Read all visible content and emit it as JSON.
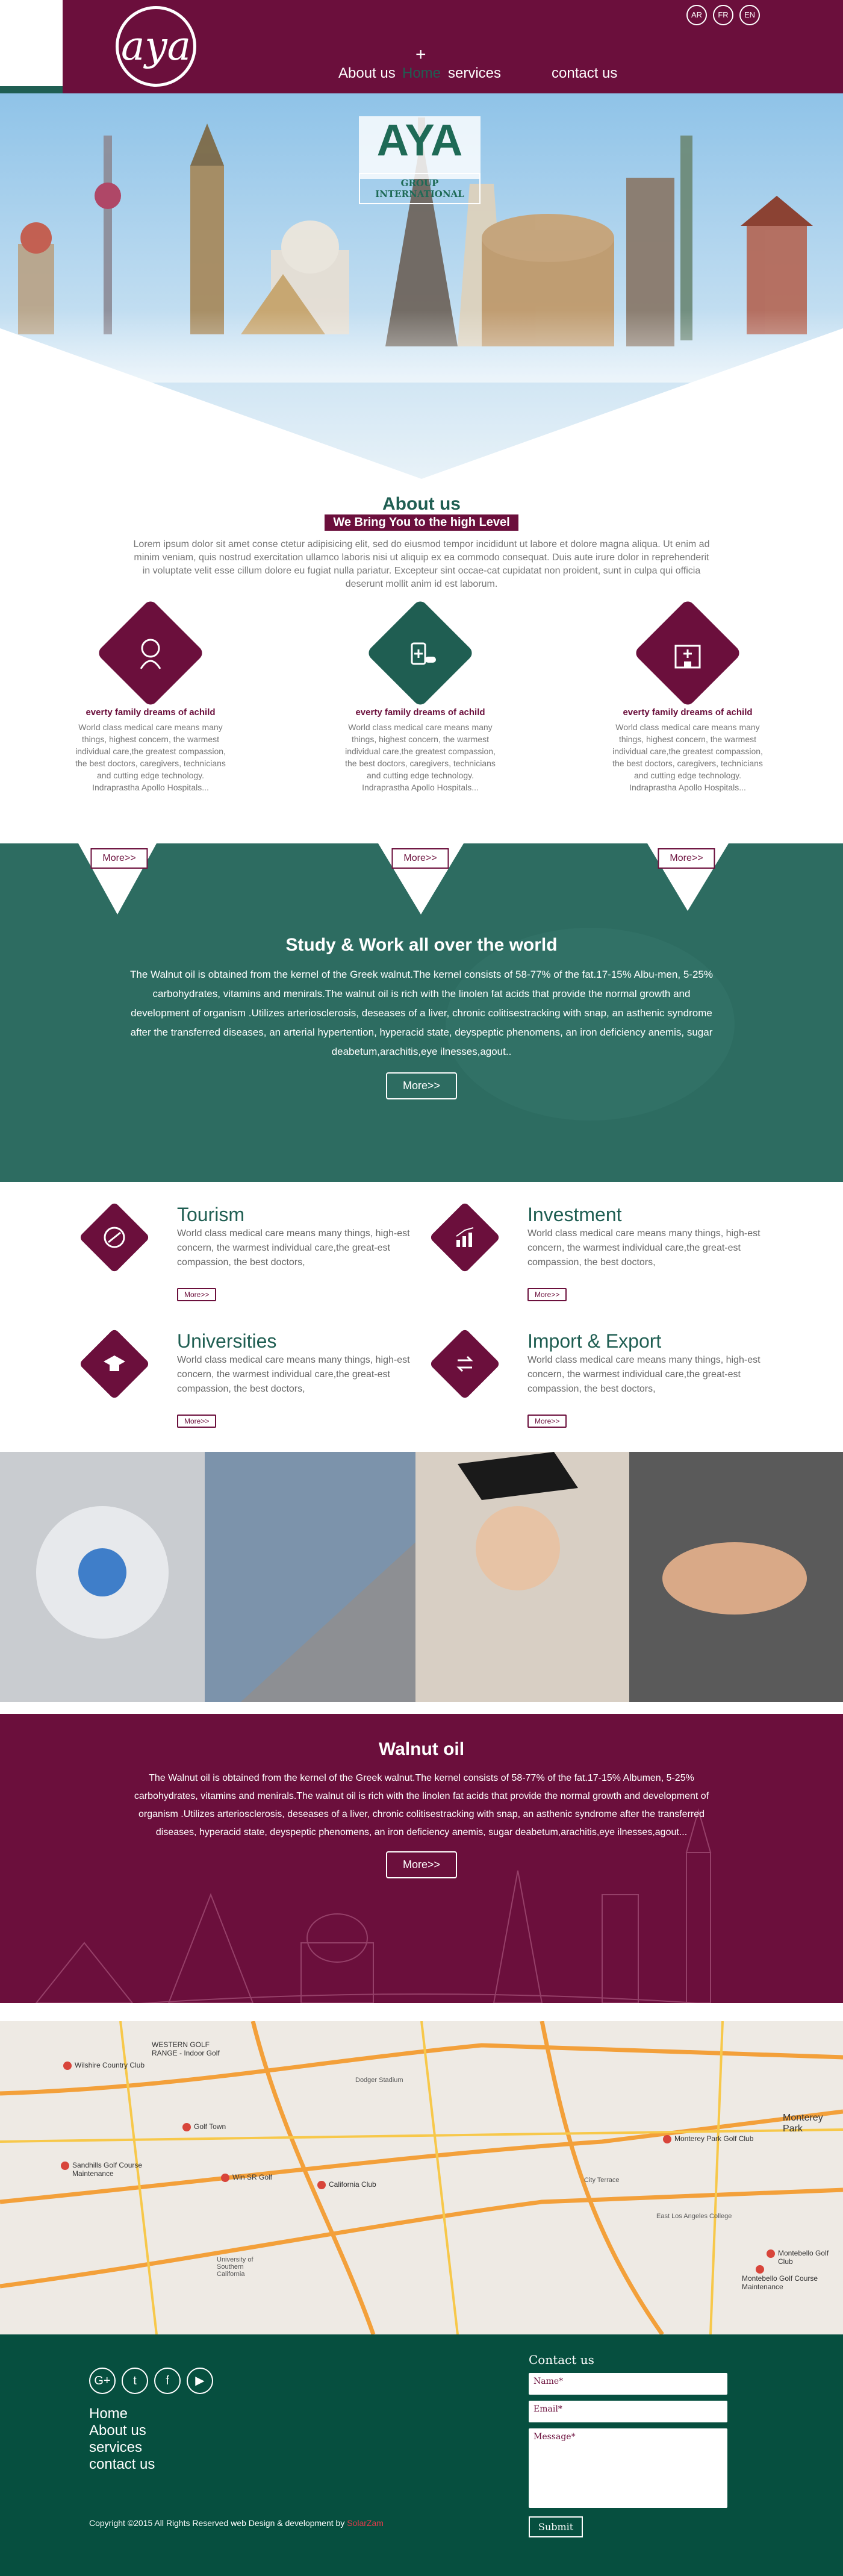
{
  "header": {
    "logo_text": "aya",
    "nav": [
      {
        "label": "Home",
        "active": true
      },
      {
        "label": "About us"
      },
      {
        "label": "services"
      },
      {
        "label": "contact us"
      }
    ],
    "languages": [
      "AR",
      "FR",
      "EN"
    ]
  },
  "hero": {
    "brand": "AYA",
    "brand_sub": "GROUP INTERNATIONAL"
  },
  "about": {
    "title": "About us",
    "tagline": "We Bring You to the high Level",
    "text": "Lorem ipsum dolor sit amet conse ctetur adipisicing elit, sed do eiusmod tempor incididunt ut labore et dolore magna aliqua. Ut enim ad minim veniam, quis nostrud exercitation ullamco laboris nisi ut aliquip ex ea commodo consequat. Duis aute irure dolor in reprehenderit in voluptate velit esse cillum dolore eu fugiat nulla pariatur. Excepteur sint occae-cat cupidatat non proident, sunt in culpa qui officia deserunt mollit anim id est laborum.",
    "features": [
      {
        "icon": "baby-icon",
        "title": "everty family dreams  of achild",
        "text": "World class medical care means many things, highest concern, the warmest individual care,the greatest compassion, the best doctors, caregivers, technicians and cutting edge technology. Indraprastha Apollo Hospitals...",
        "button": "More>>"
      },
      {
        "icon": "medicine-icon",
        "title": "everty family dreams  of achild",
        "text": "World class medical care means many things, highest concern, the warmest individual care,the greatest compassion, the best doctors, caregivers, technicians and cutting edge technology. Indraprastha Apollo Hospitals...",
        "button": "More>>"
      },
      {
        "icon": "hospital-icon",
        "title": "everty family dreams  of achild",
        "text": "World class medical care means many things, highest concern, the warmest individual care,the greatest compassion, the best doctors, caregivers, technicians and cutting edge technology. Indraprastha Apollo Hospitals...",
        "button": "More>>"
      }
    ]
  },
  "study": {
    "title": "Study & Work all over the world",
    "text": "The Walnut oil is obtained from the kernel of the Greek walnut.The kernel consists of 58-77% of the fat.17-15% Albu-men, 5-25% carbohydrates, vitamins and menirals.The walnut oil is rich with the linolen fat acids that provide the normal growth and development of organism .Utilizes arteriosclerosis, deseases of a liver, chronic colitisestracking with snap, an asthenic syndrome after the transferred diseases, an arterial hypertention, hyperacid state, deyspeptic phenomens, an iron deficiency anemis, sugar deabetum,arachitis,eye ilnesses,agout..",
    "button": "More>>"
  },
  "services": [
    {
      "icon": "tourism-icon",
      "title": "Tourism",
      "text": "World class medical care means many things, high-est concern, the warmest individual care,the great-est compassion, the best doctors,",
      "button": "More>>"
    },
    {
      "icon": "investment-icon",
      "title": "Investment",
      "text": "World class medical care means many things, high-est concern, the warmest individual care,the great-est compassion, the best doctors,",
      "button": "More>>"
    },
    {
      "icon": "graduation-cap-icon",
      "title": "Universities",
      "text": "World class medical care means many things, high-est concern, the warmest individual care,the great-est compassion, the best doctors,",
      "button": "More>>"
    },
    {
      "icon": "exchange-icon",
      "title": "Import & Export",
      "text": "World class medical care means many things, high-est concern, the warmest individual care,the great-est compassion, the best doctors,",
      "button": "More>>"
    }
  ],
  "walnut": {
    "title": "Walnut oil",
    "text": "The Walnut oil is obtained from the kernel of the Greek walnut.The kernel consists of 58-77% of the fat.17-15% Albumen, 5-25% carbohydrates, vitamins and menirals.The walnut oil is rich with the linolen fat acids that provide the normal growth and development of organism .Utilizes arteriosclerosis, deseases of a liver, chronic colitisestracking with snap, an asthenic syndrome after the transferred diseases, hyperacid state, deyspeptic phenomens, an iron deficiency anemis, sugar deabetum,arachitis,eye ilnesses,agout...",
    "button": "More>>"
  },
  "map": {
    "labels": [
      "WESTERN GOLF RANGE - Indoor Golf",
      "Wilshire Country Club",
      "Dodger Stadium",
      "Golf Town",
      "Sandhills Golf Course Maintenance",
      "Win SR Golf",
      "California Club",
      "Monterey Park Golf Club",
      "Monterey Park",
      "East Los Angeles College",
      "Montebello Golf Club",
      "Montebello Golf Course Maintenance",
      "University of Southern California",
      "City Terrace"
    ]
  },
  "footer": {
    "social": [
      "google-plus-icon",
      "twitter-icon",
      "facebook-icon",
      "youtube-icon"
    ],
    "social_glyphs": [
      "G+",
      "t",
      "f",
      "▶"
    ],
    "links": [
      "Home",
      "About us",
      "services",
      "contact us"
    ],
    "copyright": "Copyright ©2015 All Rights Reserved web Design & development by ",
    "brand": "SolarZam",
    "contact_title": "Contact us",
    "name_placeholder": "Name*",
    "email_placeholder": "Email*",
    "message_placeholder": "Message*",
    "submit": "Submit"
  },
  "colors": {
    "maroon": "#6b0f3c",
    "green": "#1f5e52",
    "footer": "#064f3f"
  }
}
